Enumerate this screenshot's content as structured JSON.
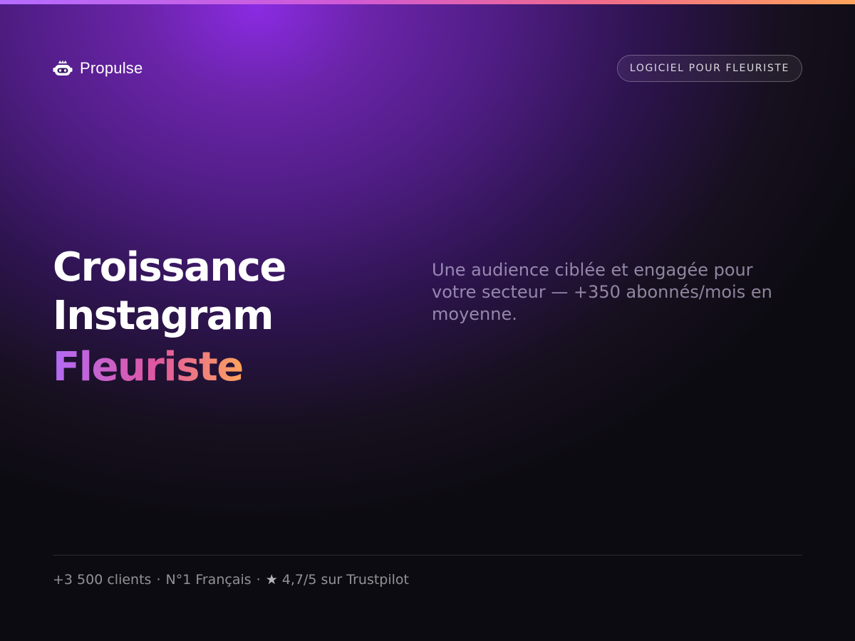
{
  "brand": {
    "name": "Propulse",
    "icon": "robot-crown-icon"
  },
  "header": {
    "badge": "LOGICIEL POUR FLEURISTE"
  },
  "hero": {
    "title_line1": "Croissance",
    "title_line2": "Instagram",
    "title_accent": "Fleuriste",
    "subtitle": "Une audience ciblée et engagée pour votre secteur — +350 abonnés/mois en moyenne."
  },
  "footer": {
    "clients": "+3 500 clients",
    "separator": "·",
    "rank": "N°1 Français",
    "star_icon": "★",
    "rating": "4,7/5 sur Trustpilot"
  },
  "colors": {
    "background": "#0d0b12",
    "glow": "#8a2be2",
    "gradient_start": "#b36bf5",
    "gradient_mid": "#e0579f",
    "gradient_end": "#ffa45c"
  }
}
